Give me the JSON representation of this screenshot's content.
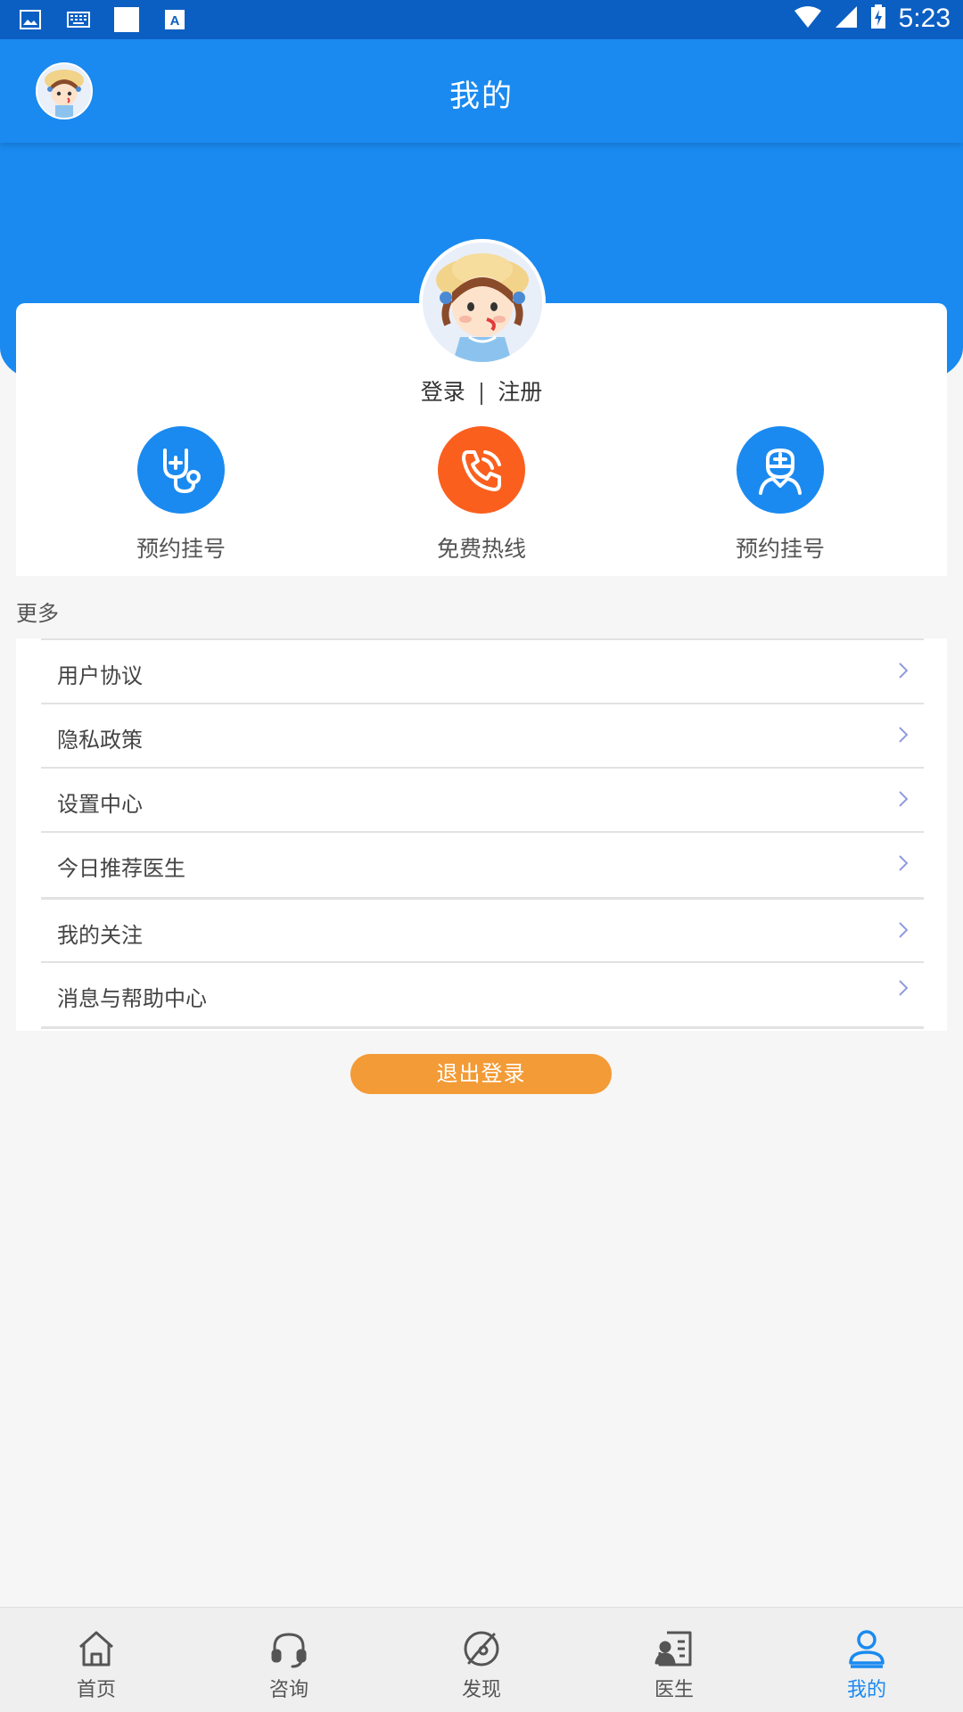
{
  "status_bar": {
    "time": "5:23",
    "left_icons": [
      "image-icon",
      "keyboard-icon",
      "blank-square-icon",
      "font-a-icon"
    ],
    "right_icons": [
      "wifi-icon",
      "cell-signal-icon",
      "battery-charging-icon"
    ]
  },
  "header": {
    "title": "我的"
  },
  "profile": {
    "login_label": "登录",
    "separator": "|",
    "register_label": "注册"
  },
  "quick_actions": [
    {
      "label": "预约挂号",
      "icon": "stethoscope-icon",
      "color": "#1a8af0"
    },
    {
      "label": "免费热线",
      "icon": "phone-call-icon",
      "color": "#fb5f1e"
    },
    {
      "label": "预约挂号",
      "icon": "doctor-icon",
      "color": "#1a8af0"
    }
  ],
  "more": {
    "section_label": "更多",
    "items": [
      {
        "label": "用户协议"
      },
      {
        "label": "隐私政策"
      },
      {
        "label": "设置中心"
      },
      {
        "label": "今日推荐医生"
      },
      {
        "label": "我的关注"
      },
      {
        "label": "消息与帮助中心"
      }
    ]
  },
  "logout_label": "退出登录",
  "bottom_nav": {
    "active_index": 4,
    "items": [
      {
        "label": "首页",
        "icon": "home-icon"
      },
      {
        "label": "咨询",
        "icon": "headset-icon"
      },
      {
        "label": "发现",
        "icon": "compass-icon"
      },
      {
        "label": "医生",
        "icon": "doctor-card-icon"
      },
      {
        "label": "我的",
        "icon": "user-icon"
      }
    ]
  },
  "colors": {
    "primary": "#1a8af0",
    "status_bar": "#0c5fc2",
    "hotline": "#fb5f1e",
    "logout": "#f39b36"
  }
}
